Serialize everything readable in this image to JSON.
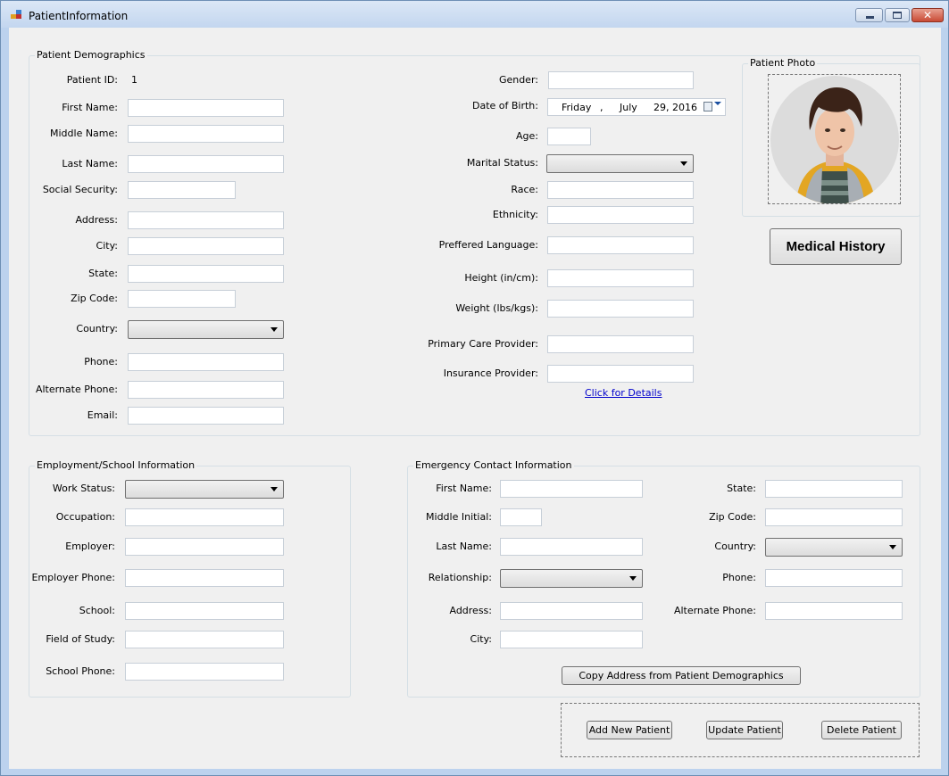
{
  "window": {
    "title": "PatientInformation"
  },
  "demographics": {
    "group_title": "Patient Demographics",
    "patient_id_label": "Patient ID:",
    "patient_id_value": "1",
    "first_name_label": "First Name:",
    "middle_name_label": "Middle Name:",
    "last_name_label": "Last Name:",
    "ssn_label": "Social Security:",
    "address_label": "Address:",
    "city_label": "City:",
    "state_label": "State:",
    "zip_label": "Zip Code:",
    "country_label": "Country:",
    "phone_label": "Phone:",
    "alt_phone_label": "Alternate Phone:",
    "email_label": "Email:",
    "gender_label": "Gender:",
    "dob_label": "Date of Birth:",
    "dob_day": "Friday",
    "dob_sep": ",",
    "dob_month": "July",
    "dob_date": "29, 2016",
    "age_label": "Age:",
    "marital_label": "Marital Status:",
    "race_label": "Race:",
    "ethnicity_label": "Ethnicity:",
    "language_label": "Preffered Language:",
    "height_label": "Height (in/cm):",
    "weight_label": "Weight (lbs/kgs):",
    "pcp_label": "Primary Care Provider:",
    "insurance_label": "Insurance Provider:",
    "details_link": "Click for Details"
  },
  "photo": {
    "group_title": "Patient Photo"
  },
  "medical_history_button": "Medical History",
  "employment": {
    "group_title": "Employment/School Information",
    "work_status_label": "Work Status:",
    "occupation_label": "Occupation:",
    "employer_label": "Employer:",
    "employer_phone_label": "Employer Phone:",
    "school_label": "School:",
    "field_label": "Field of Study:",
    "school_phone_label": "School Phone:"
  },
  "emergency": {
    "group_title": "Emergency Contact Information",
    "first_name_label": "First Name:",
    "middle_initial_label": "Middle Initial:",
    "last_name_label": "Last Name:",
    "relationship_label": "Relationship:",
    "address_label": "Address:",
    "city_label": "City:",
    "state_label": "State:",
    "zip_label": "Zip Code:",
    "country_label": "Country:",
    "phone_label": "Phone:",
    "alt_phone_label": "Alternate Phone:",
    "copy_button": "Copy Address from Patient Demographics"
  },
  "actions": {
    "add": "Add New Patient",
    "update": "Update Patient",
    "delete": "Delete Patient"
  },
  "colors": {
    "titlebar": "#c3d6ef",
    "form_bg": "#f0f0f0",
    "link": "#0000cc"
  }
}
